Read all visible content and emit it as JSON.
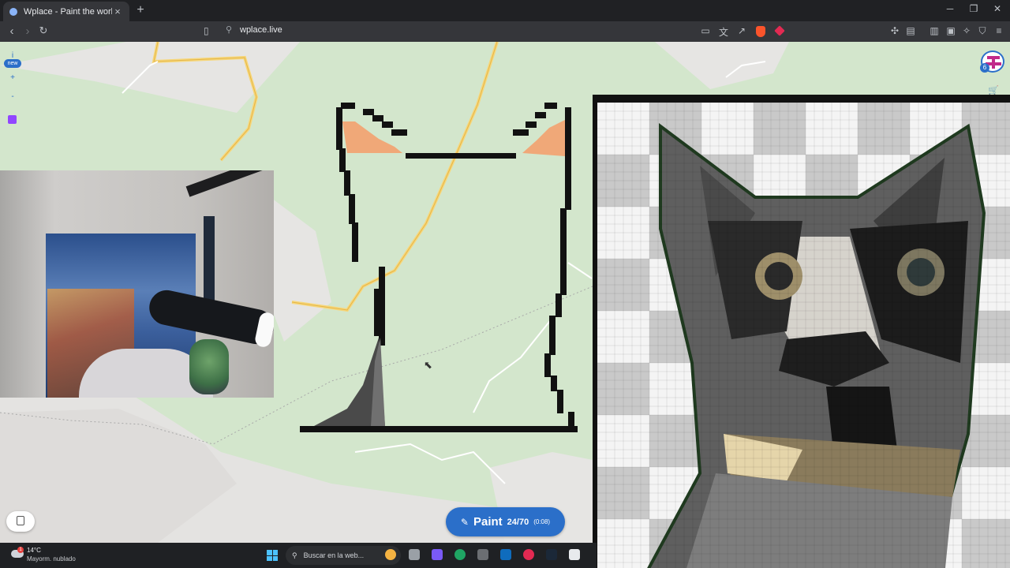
{
  "browser": {
    "tab_title": "Wplace - Paint the world",
    "tab_close": "×",
    "new_tab": "+",
    "url": "wplace.live",
    "window_controls": [
      "─",
      "❐",
      "✕"
    ]
  },
  "map": {
    "side_controls": {
      "info": "i",
      "new_badge": "new",
      "zoom_in": "+",
      "zoom_out": "-"
    },
    "user_badge_count": "6",
    "paint_button": {
      "label": "Paint",
      "count": "24/70",
      "timer": "(0:08)"
    }
  },
  "taskbar": {
    "weather_alert": "1",
    "temperature": "14°C",
    "weather_desc": "Mayorm. nublado",
    "search_placeholder": "Buscar en la web..."
  },
  "colors": {
    "map_background": "#d3e6cc",
    "accent_blue": "#2b6fc9",
    "outline_black": "#111111",
    "ear_peach": "#f0a878"
  }
}
